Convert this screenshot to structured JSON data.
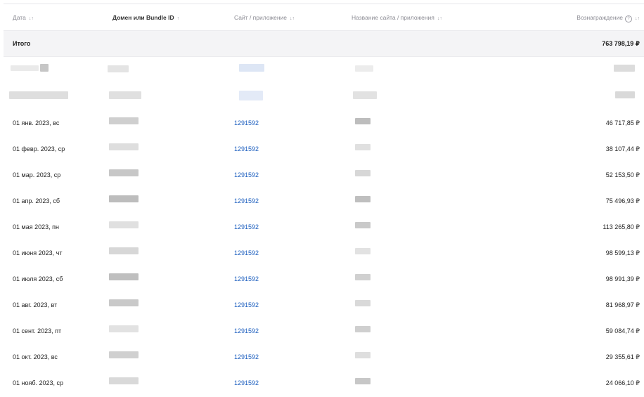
{
  "header": {
    "date": "Дата",
    "domain": "Домен или Bundle ID",
    "site": "Сайт / приложение",
    "site_name": "Название сайта / приложения",
    "reward": "Вознаграждение",
    "sort_icon": "↓↑",
    "sort_up": "↑",
    "help_icon": "?"
  },
  "total": {
    "label": "Итого",
    "reward": "763 798,19 ₽"
  },
  "rows": [
    {
      "date": "01 янв. 2023, вс",
      "site": "1291592",
      "reward": "46 717,85 ₽"
    },
    {
      "date": "01 февр. 2023, ср",
      "site": "1291592",
      "reward": "38 107,44 ₽"
    },
    {
      "date": "01 мар. 2023, ср",
      "site": "1291592",
      "reward": "52 153,50 ₽"
    },
    {
      "date": "01 апр. 2023, сб",
      "site": "1291592",
      "reward": "75 496,93 ₽"
    },
    {
      "date": "01 мая 2023, пн",
      "site": "1291592",
      "reward": "113 265,80 ₽"
    },
    {
      "date": "01 июня 2023, чт",
      "site": "1291592",
      "reward": "98 599,13 ₽"
    },
    {
      "date": "01 июля 2023, сб",
      "site": "1291592",
      "reward": "98 991,39 ₽"
    },
    {
      "date": "01 авг. 2023, вт",
      "site": "1291592",
      "reward": "81 968,97 ₽"
    },
    {
      "date": "01 сент. 2023, пт",
      "site": "1291592",
      "reward": "59 084,74 ₽"
    },
    {
      "date": "01 окт. 2023, вс",
      "site": "1291592",
      "reward": "29 355,61 ₽"
    },
    {
      "date": "01 нояб. 2023, ср",
      "site": "1291592",
      "reward": "24 066,10 ₽"
    }
  ]
}
